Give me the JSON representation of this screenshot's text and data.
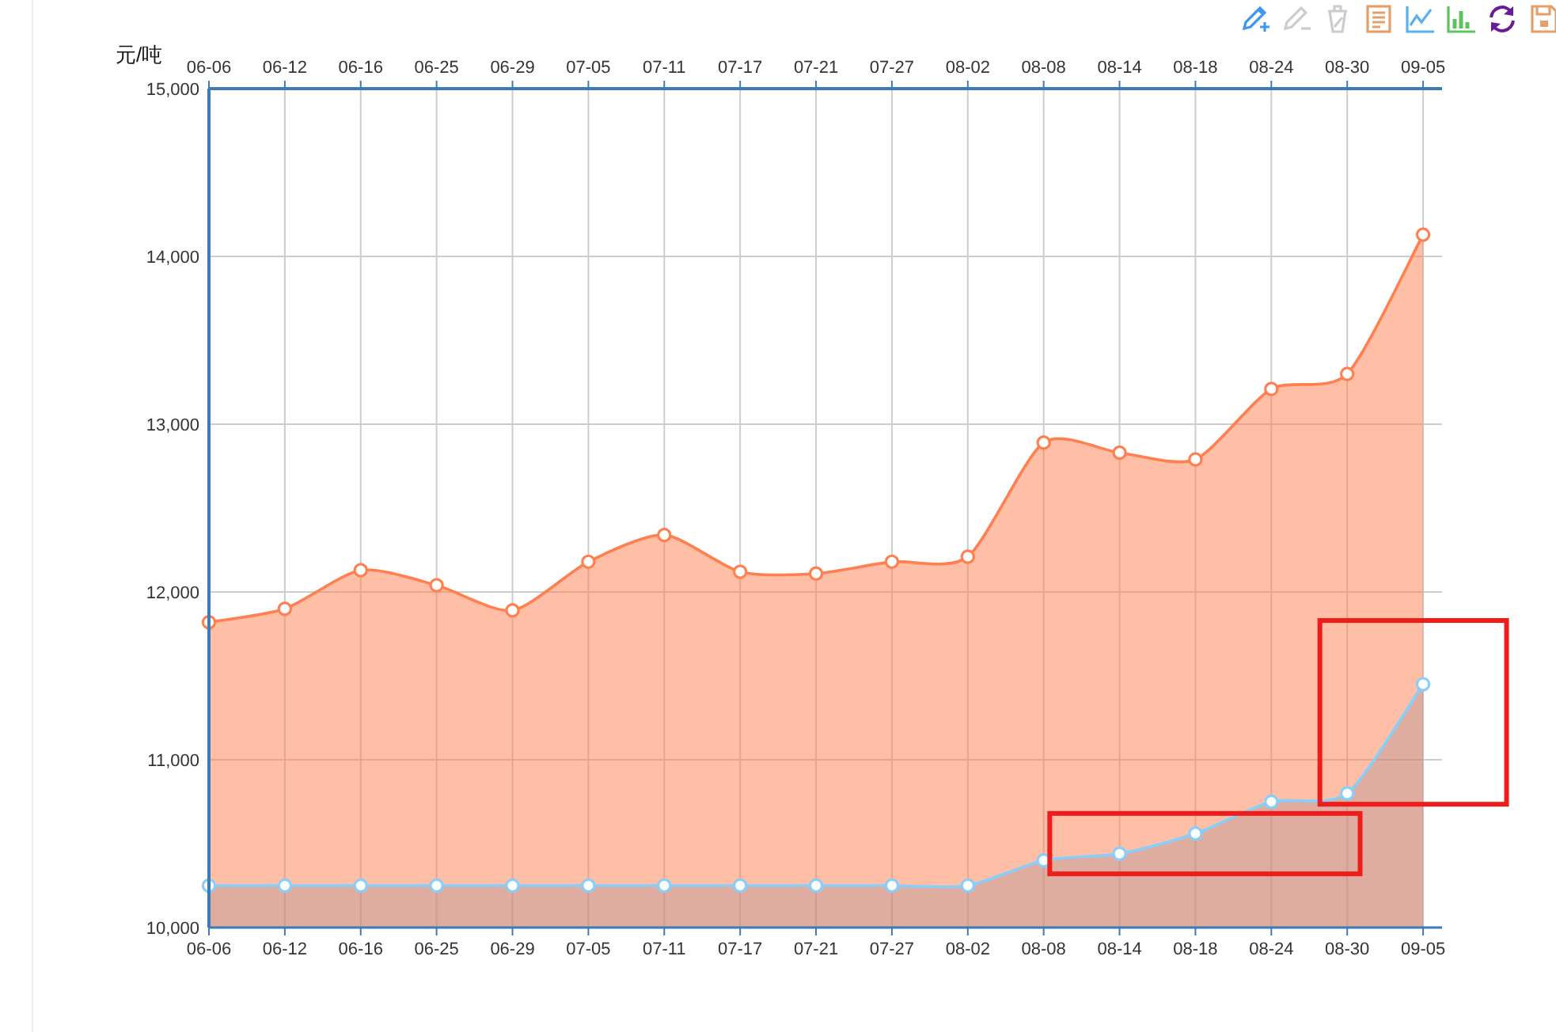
{
  "toolbox": [
    {
      "kind": "mark",
      "color": "#3e98f0",
      "disabled": false
    },
    {
      "kind": "mark-undo",
      "disabled": true
    },
    {
      "kind": "mark-clear",
      "disabled": true
    },
    {
      "kind": "data-view",
      "color": "#e5a06a",
      "disabled": false
    },
    {
      "kind": "line",
      "color": "#5ab1ef",
      "disabled": false
    },
    {
      "kind": "bar",
      "color": "#5cc45c",
      "disabled": false
    },
    {
      "kind": "restore",
      "color": "#6a1b9a",
      "disabled": false
    },
    {
      "kind": "save",
      "color": "#e5a06a",
      "disabled": false
    }
  ],
  "chart_data": {
    "type": "area",
    "ylabel": "元/吨",
    "grid": true,
    "categories": [
      "06-06",
      "06-12",
      "06-16",
      "06-25",
      "06-29",
      "07-05",
      "07-11",
      "07-17",
      "07-21",
      "07-27",
      "08-02",
      "08-08",
      "08-14",
      "08-18",
      "08-24",
      "08-30",
      "09-05"
    ],
    "series": [
      {
        "color": "#ff7f50",
        "values": [
          11820,
          11900,
          12130,
          12040,
          11890,
          12180,
          12340,
          12120,
          12110,
          12180,
          12210,
          12890,
          12830,
          12790,
          13210,
          13300,
          14130
        ]
      },
      {
        "color": "#87cefa",
        "values": [
          10250,
          10250,
          10250,
          10250,
          10250,
          10250,
          10250,
          10250,
          10250,
          10250,
          10250,
          10400,
          10440,
          10560,
          10750,
          10800,
          11450
        ]
      }
    ],
    "ylim": [
      10000,
      15000
    ],
    "yticks": [
      {
        "value": 10000,
        "label": "10,000"
      },
      {
        "value": 11000,
        "label": "11,000"
      },
      {
        "value": 12000,
        "label": "12,000"
      },
      {
        "value": 13000,
        "label": "13,000"
      },
      {
        "value": 14000,
        "label": "14,000"
      },
      {
        "value": 15000,
        "label": "15,000"
      }
    ]
  }
}
